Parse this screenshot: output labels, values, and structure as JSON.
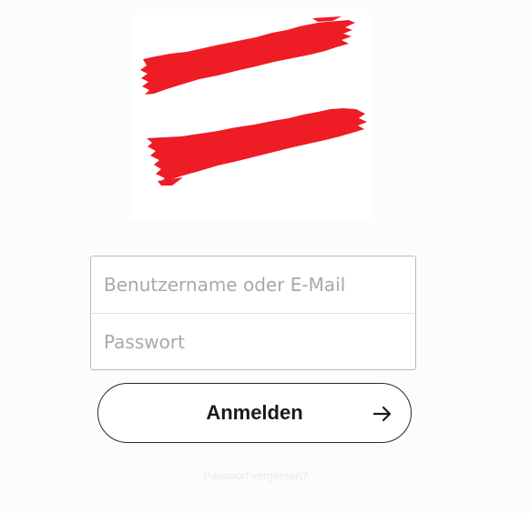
{
  "logo": {
    "name": "red-stripes-logo",
    "color": "#ee1c24"
  },
  "form": {
    "username_placeholder": "Benutzername oder E-Mail",
    "password_placeholder": "Passwort"
  },
  "login_button": {
    "label": "Anmelden",
    "icon": "arrow-right-icon"
  },
  "forgot_password": {
    "label": "Passwort vergessen?"
  }
}
